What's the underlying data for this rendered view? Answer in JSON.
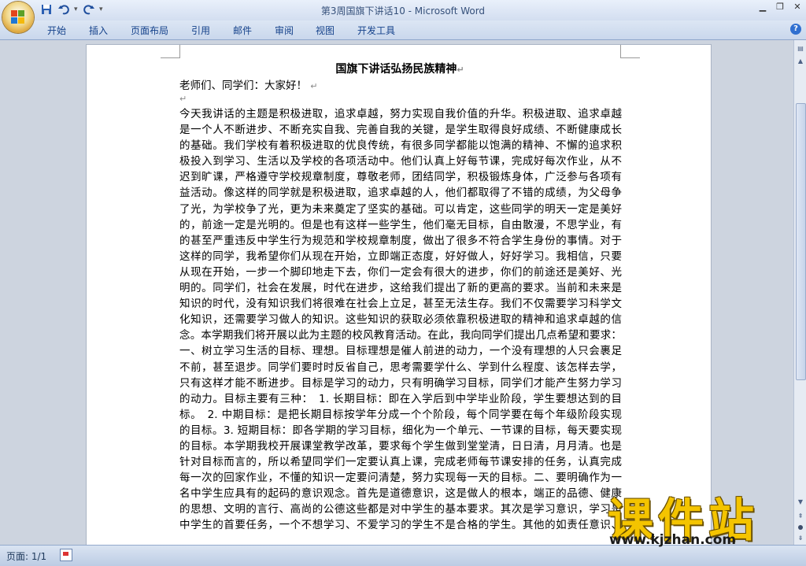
{
  "window": {
    "title": "第3周国旗下讲话10 - Microsoft Word",
    "qat": [
      "save-icon",
      "undo-icon",
      "redo-icon"
    ]
  },
  "ribbon": {
    "tabs": [
      "开始",
      "插入",
      "页面布局",
      "引用",
      "邮件",
      "审阅",
      "视图",
      "开发工具"
    ]
  },
  "document": {
    "title": "国旗下讲话弘扬民族精神",
    "greeting": "老师们、同学们：大家好！",
    "lines": [
      "今天我讲话的主题是积极进取，追求卓越，努力实现自我价值的升华。积极进取、追求卓越",
      "是一个人不断进步、不断充实自我、完善自我的关键，是学生取得良好成绩、不断健康成长",
      "的基础。我们学校有着积极进取的优良传统，有很多同学都能以饱满的精神、不懈的追求积",
      "极投入到学习、生活以及学校的各项活动中。他们认真上好每节课，完成好每次作业，从不",
      "迟到旷课，严格遵守学校规章制度，尊敬老师，团结同学，积极锻炼身体，广泛参与各项有",
      "益活动。像这样的同学就是积极进取，追求卓越的人，他们都取得了不错的成绩，为父母争",
      "了光，为学校争了光，更为未来奠定了坚实的基础。可以肯定，这些同学的明天一定是美好",
      "的，前途一定是光明的。但是也有这样一些学生，他们毫无目标，自由散漫，不思学业，有",
      "的甚至严重违反中学生行为规范和学校规章制度，做出了很多不符合学生身份的事情。对于",
      "这样的同学，我希望你们从现在开始，立即端正态度，好好做人，好好学习。我相信，只要",
      "从现在开始，一步一个脚印地走下去，你们一定会有很大的进步，你们的前途还是美好、光",
      "明的。同学们，社会在发展，时代在进步，这给我们提出了新的更高的要求。当前和未来是",
      "知识的时代，没有知识我们将很难在社会上立足，甚至无法生存。我们不仅需要学习科学文",
      "化知识，还需要学习做人的知识。这些知识的获取必须依靠积极进取的精神和追求卓越的信",
      "念。本学期我们将开展以此为主题的校风教育活动。在此，我向同学们提出几点希望和要求：",
      "一、树立学习生活的目标、理想。目标理想是催人前进的动力，一个没有理想的人只会裹足",
      "不前，甚至退步。同学们要时时反省自己，思考需要学什么、学到什么程度、该怎样去学，",
      "只有这样才能不断进步。目标是学习的动力，只有明确学习目标，同学们才能产生努力学习",
      "的动力。目标主要有三种：　1. 长期目标：即在入学后到中学毕业阶段，学生要想达到的目",
      "标。　2. 中期目标：是把长期目标按学年分成一个个阶段，每个同学要在每个年级阶段实现",
      "的目标。3. 短期目标：即各学期的学习目标，细化为一个单元、一节课的目标，每天要实现",
      "的目标。本学期我校开展课堂教学改革，要求每个学生做到堂堂清，日日清，月月清。也是",
      "针对目标而言的，所以希望同学们一定要认真上课，完成老师每节课安排的任务，认真完成",
      "每一次的回家作业，不懂的知识一定要问清楚，努力实现每一天的目标。二、要明确作为一",
      "名中学生应具有的起码的意识观念。首先是道德意识，这是做人的根本，端正的品德、健康",
      "的思想、文明的言行、高尚的公德这些都是对中学生的基本要求。其次是学习意识，学习是",
      "中学生的首要任务，一个不想学习、不爱学习的学生不是合格的学生。其他的如责任意识、"
    ]
  },
  "status": {
    "page": "页面: 1/1"
  },
  "watermark": {
    "brand": "课件站",
    "url": "www.kjzhan.com"
  }
}
